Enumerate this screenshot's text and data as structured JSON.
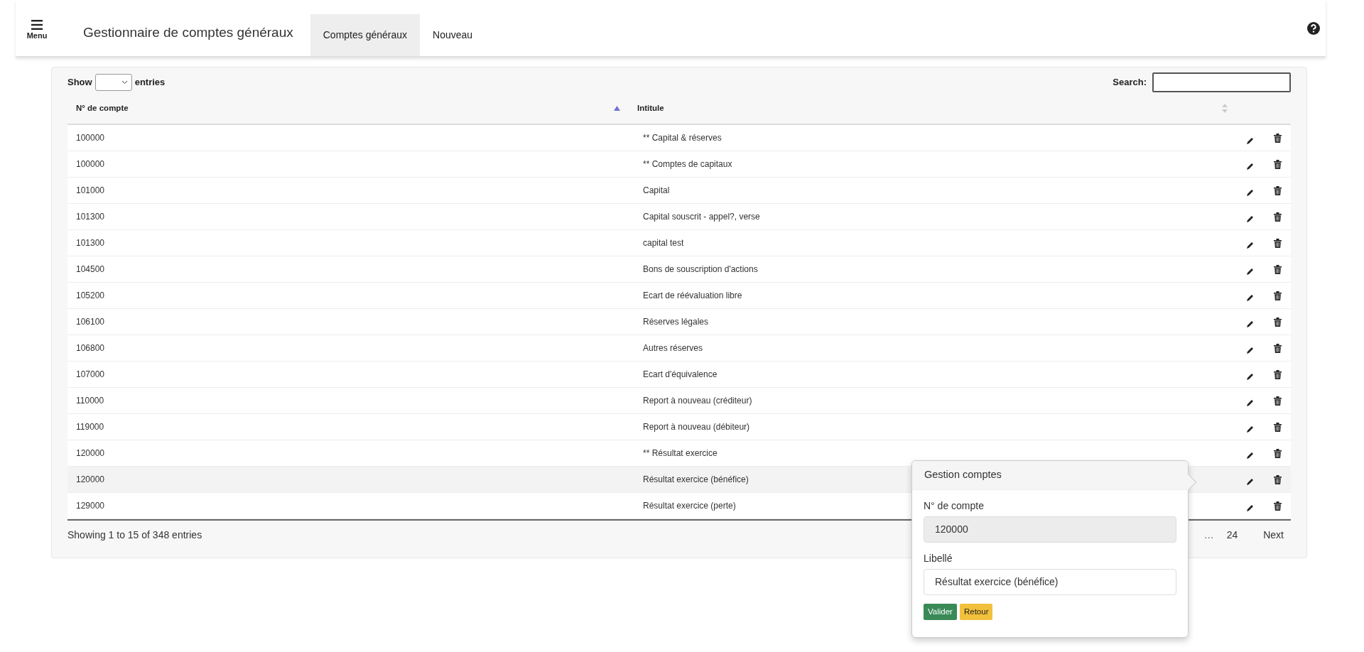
{
  "navbar": {
    "menu_label": "Menu",
    "title": "Gestionnaire de comptes généraux",
    "tabs": [
      {
        "label": "Comptes généraux",
        "selected": true
      },
      {
        "label": "Nouveau",
        "selected": false
      }
    ]
  },
  "table_controls": {
    "show_label": "Show",
    "entries_label": "entries",
    "search_label": "Search:"
  },
  "table": {
    "columns": [
      {
        "label": "N° de compte",
        "sorted": true
      },
      {
        "label": "Intitule",
        "sorted": false
      }
    ],
    "rows": [
      {
        "account": "100000",
        "title": "** Capital & réserves",
        "selected": false
      },
      {
        "account": "100000",
        "title": "** Comptes de capitaux",
        "selected": false
      },
      {
        "account": "101000",
        "title": "Capital",
        "selected": false
      },
      {
        "account": "101300",
        "title": "Capital souscrit - appel?, verse",
        "selected": false
      },
      {
        "account": "101300",
        "title": "capital test",
        "selected": false
      },
      {
        "account": "104500",
        "title": "Bons de souscription d'actions",
        "selected": false
      },
      {
        "account": "105200",
        "title": "Ecart de réévaluation libre",
        "selected": false
      },
      {
        "account": "106100",
        "title": "Réserves légales",
        "selected": false
      },
      {
        "account": "106800",
        "title": "Autres réserves",
        "selected": false
      },
      {
        "account": "107000",
        "title": "Ecart d'équivalence",
        "selected": false
      },
      {
        "account": "110000",
        "title": "Report à nouveau (créditeur)",
        "selected": false
      },
      {
        "account": "119000",
        "title": "Report à nouveau (débiteur)",
        "selected": false
      },
      {
        "account": "120000",
        "title": "** Résultat exercice",
        "selected": false
      },
      {
        "account": "120000",
        "title": "Résultat exercice (bénéfice)",
        "selected": true
      },
      {
        "account": "129000",
        "title": "Résultat exercice (perte)",
        "selected": false
      }
    ]
  },
  "info": "Showing 1 to 15 of 348 entries",
  "pagination": [
    {
      "label": "…",
      "kind": "ellipsis"
    },
    {
      "label": "24",
      "kind": "page"
    },
    {
      "label": "Next",
      "kind": "next"
    }
  ],
  "popover": {
    "title": "Gestion comptes",
    "fields": [
      {
        "label": "N° de compte",
        "value": "120000",
        "disabled": true
      },
      {
        "label": "Libellé",
        "value": "Résultat exercice (bénéfice)",
        "disabled": false
      }
    ],
    "buttons": [
      {
        "label": "Valider",
        "kind": "success"
      },
      {
        "label": "Retour",
        "kind": "warning"
      }
    ]
  }
}
